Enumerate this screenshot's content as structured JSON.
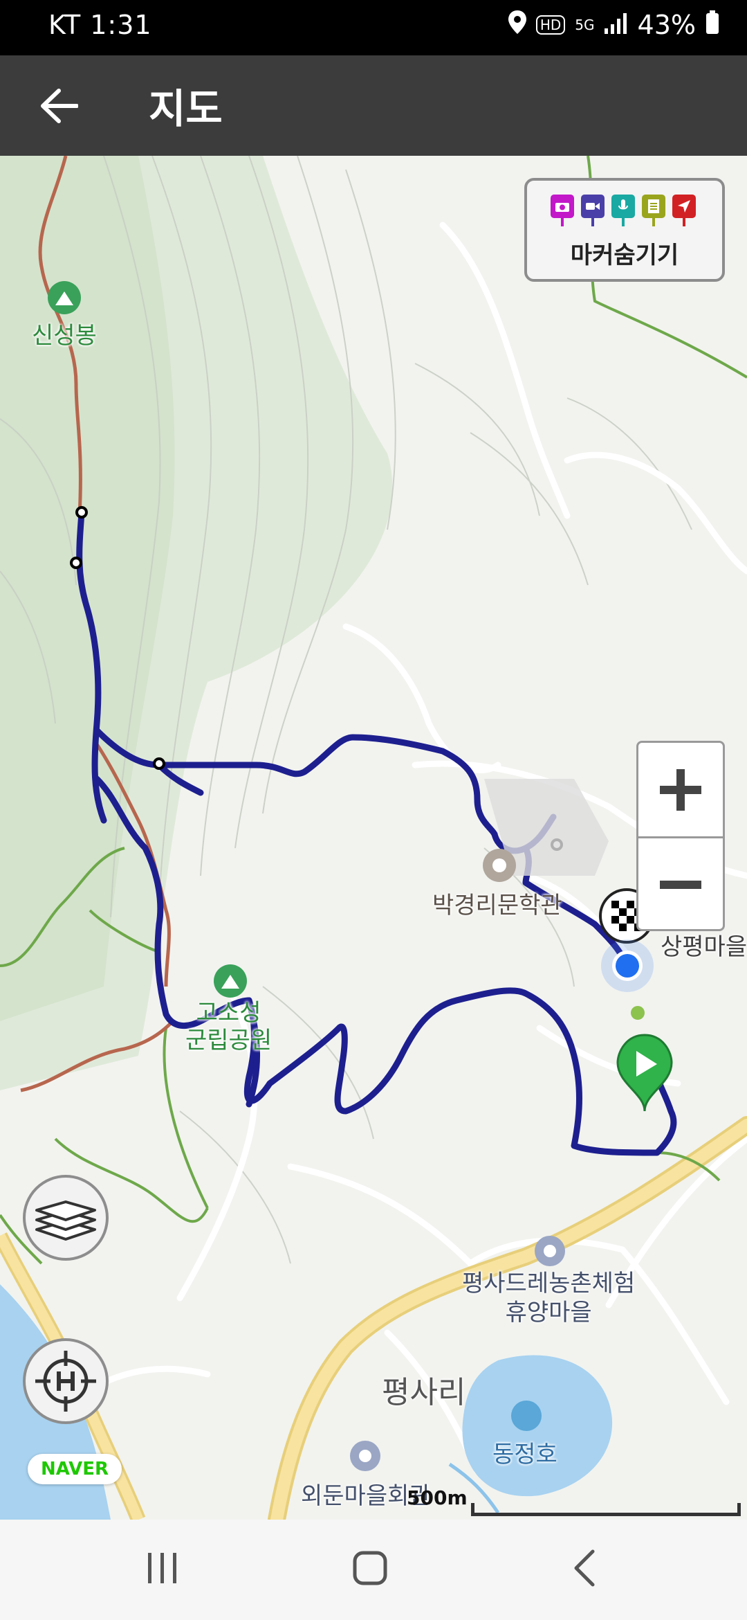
{
  "status_bar": {
    "carrier_time": "KT 1:31",
    "battery": "43%",
    "hd_badge": "HD",
    "network": "5G"
  },
  "app_bar": {
    "title": "지도",
    "back_icon": "arrow-left-icon"
  },
  "marker_toggle": {
    "label": "마커숨기기",
    "icons": [
      "camera-pin",
      "video-pin",
      "voice-pin",
      "memo-pin",
      "flag-pin"
    ],
    "colors": [
      "#c218c9",
      "#4a3fa8",
      "#1aa9a3",
      "#9aa51e",
      "#d22124"
    ]
  },
  "zoom": {
    "plus": "+",
    "minus": "−"
  },
  "map": {
    "places": [
      {
        "name": "신성봉"
      },
      {
        "name": "박경리문학관"
      },
      {
        "name": "상평마을"
      },
      {
        "name": "고소성\n군립공원"
      },
      {
        "name": "평사드레농촌체험\n휴양마을"
      },
      {
        "name": "평사리"
      },
      {
        "name": "동정호"
      },
      {
        "name": "외둔마을회관"
      }
    ],
    "colors": {
      "track": "#1d1f8f",
      "trail_green": "#6ea84a",
      "trail_red": "#c25a4a",
      "road": "#ffffff",
      "main_road": "#f7e08c",
      "water": "#a8d2f0"
    }
  },
  "scale": "500m",
  "logo": "NAVER",
  "buttons": {
    "layers": "layers-icon",
    "home_position": "home-location-icon"
  }
}
